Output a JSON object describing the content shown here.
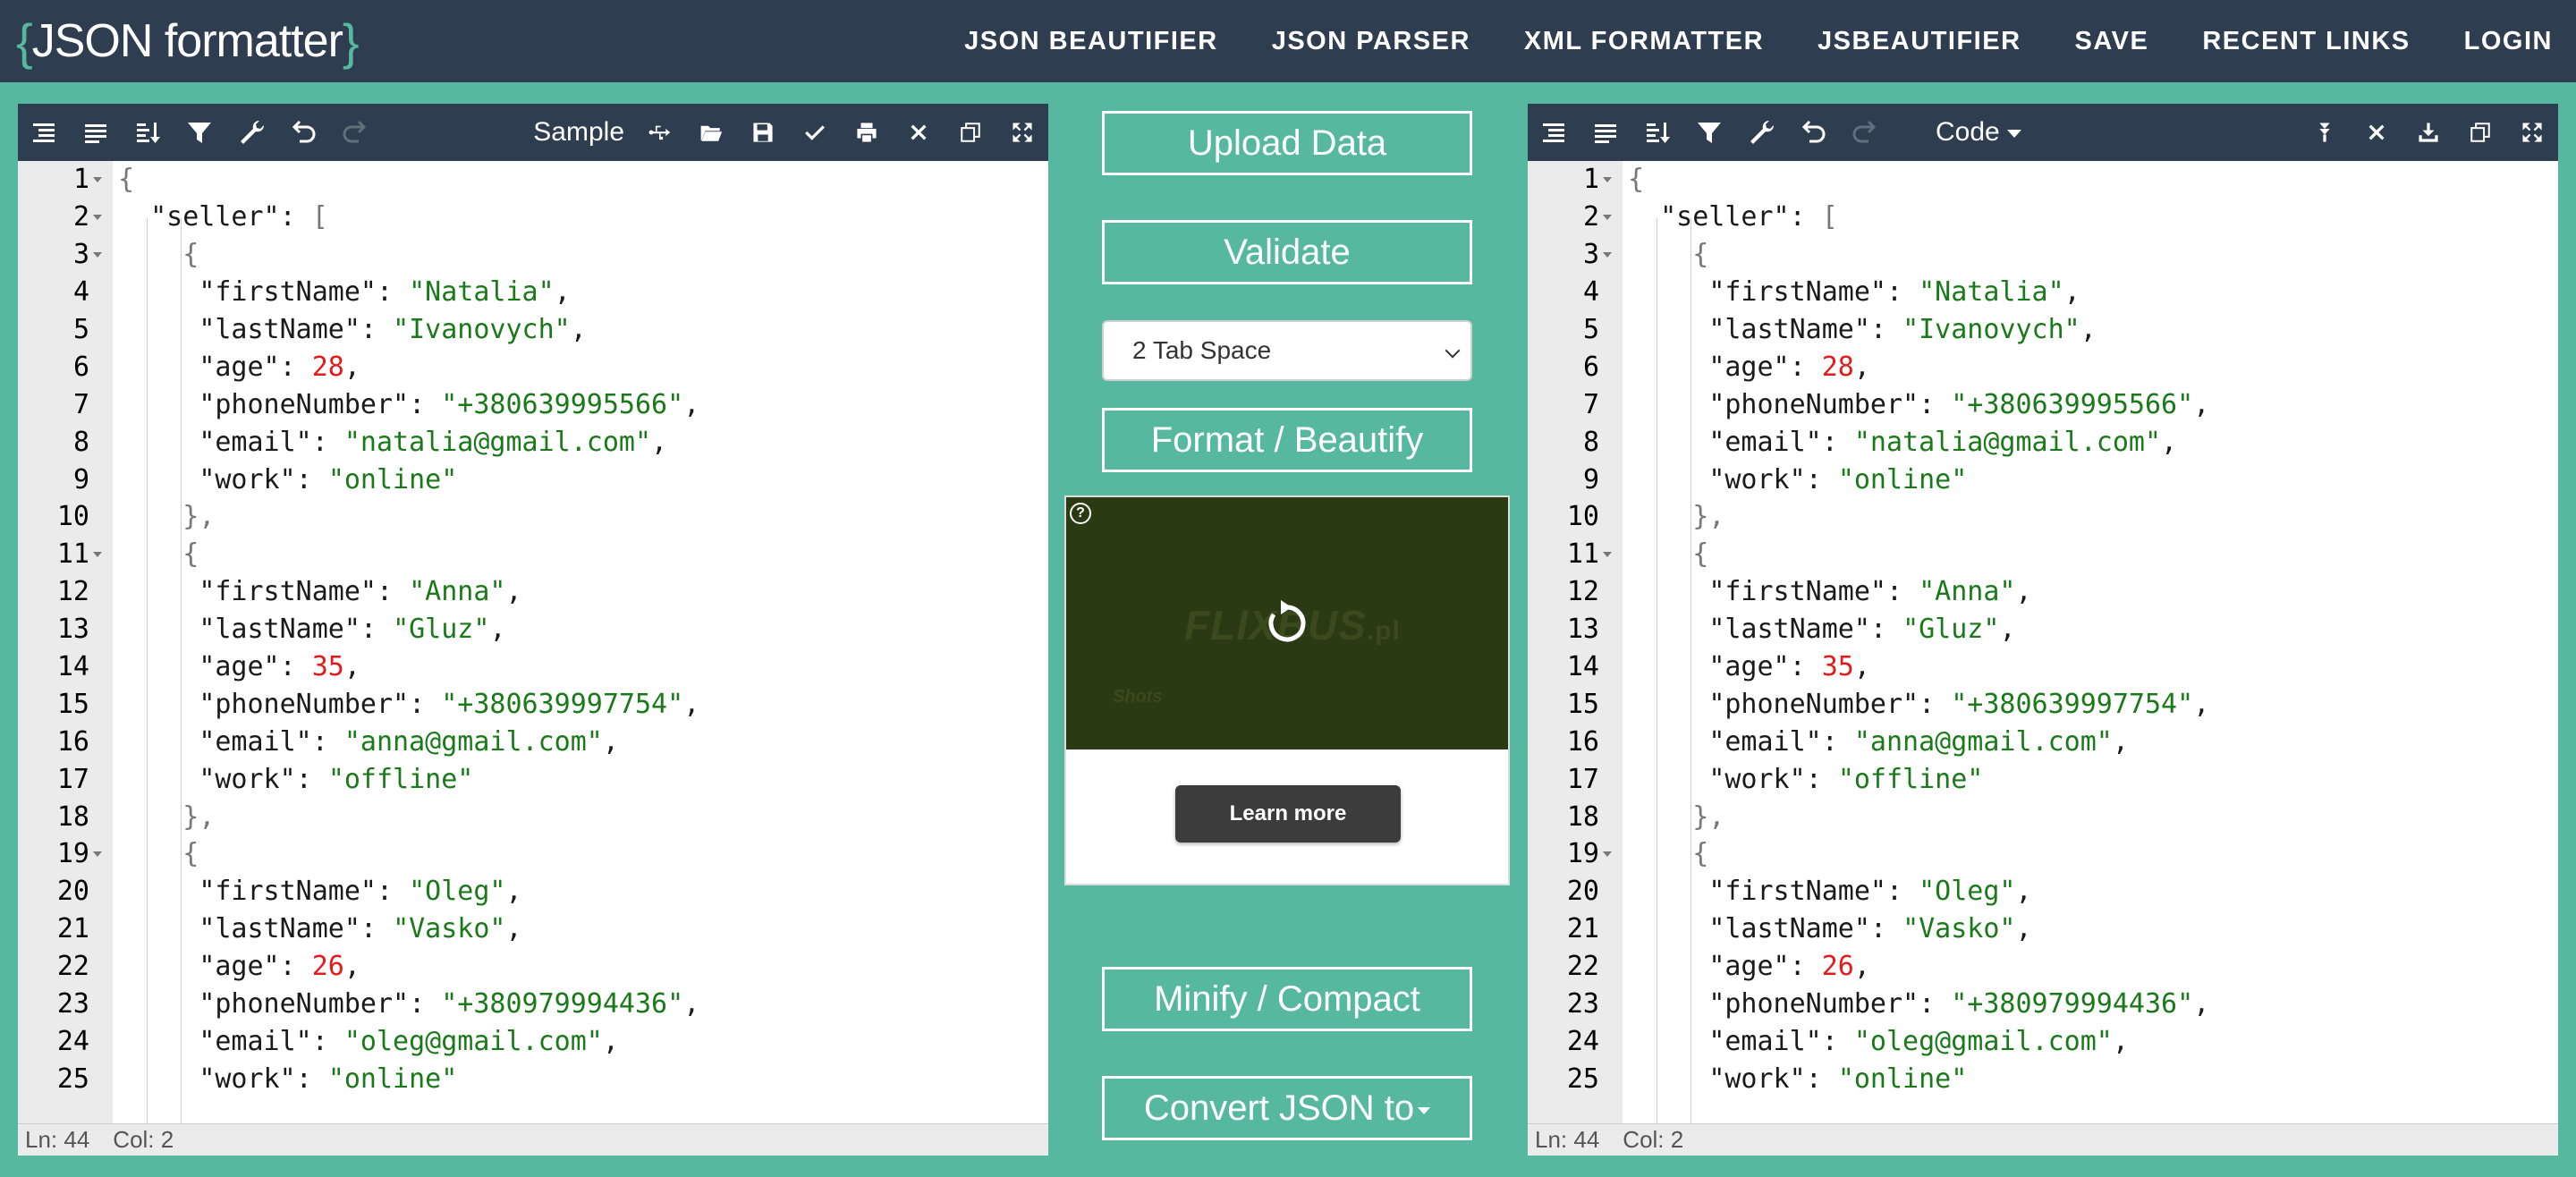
{
  "header": {
    "logo_open": "{",
    "logo_text": "JSON formatter",
    "logo_close": "}",
    "nav": [
      "JSON BEAUTIFIER",
      "JSON PARSER",
      "XML FORMATTER",
      "JSBEAUTIFIER",
      "SAVE",
      "RECENT LINKS",
      "LOGIN"
    ]
  },
  "left_pane": {
    "toolbar_label": "Sample",
    "status": {
      "line": "Ln: 44",
      "col": "Col: 2"
    }
  },
  "right_pane": {
    "toolbar_label": "Code",
    "status": {
      "line": "Ln: 44",
      "col": "Col: 2"
    }
  },
  "middle": {
    "upload_label": "Upload Data",
    "validate_label": "Validate",
    "tab_select_value": "2 Tab Space",
    "format_label": "Format / Beautify",
    "minify_label": "Minify / Compact",
    "convert_label": "Convert JSON to"
  },
  "ad": {
    "help": "?",
    "brand": "FLIXBUS",
    "brand_suffix": ".pl",
    "small_text": "Shots",
    "learn_more_label": "Learn more"
  },
  "colors": {
    "accent": "#56b89e",
    "header_bg": "#2e3d4f",
    "string": "#1a7a1a",
    "number": "#e31b1b"
  },
  "code_lines": [
    {
      "n": "1",
      "fold": true,
      "tokens": [
        [
          "b",
          "{"
        ]
      ]
    },
    {
      "n": "2",
      "fold": true,
      "tokens": [
        [
          "p",
          "  "
        ],
        [
          "k",
          "\"seller\""
        ],
        [
          "p",
          ": "
        ],
        [
          "b",
          "["
        ]
      ]
    },
    {
      "n": "3",
      "fold": true,
      "tokens": [
        [
          "p",
          "    "
        ],
        [
          "b",
          "{"
        ]
      ]
    },
    {
      "n": "4",
      "fold": false,
      "tokens": [
        [
          "p",
          "     "
        ],
        [
          "k",
          "\"firstName\""
        ],
        [
          "p",
          ": "
        ],
        [
          "s",
          "\"Natalia\""
        ],
        [
          "p",
          ","
        ]
      ]
    },
    {
      "n": "5",
      "fold": false,
      "tokens": [
        [
          "p",
          "     "
        ],
        [
          "k",
          "\"lastName\""
        ],
        [
          "p",
          ": "
        ],
        [
          "s",
          "\"Ivanovych\""
        ],
        [
          "p",
          ","
        ]
      ]
    },
    {
      "n": "6",
      "fold": false,
      "tokens": [
        [
          "p",
          "     "
        ],
        [
          "k",
          "\"age\""
        ],
        [
          "p",
          ": "
        ],
        [
          "n",
          "28"
        ],
        [
          "p",
          ","
        ]
      ]
    },
    {
      "n": "7",
      "fold": false,
      "tokens": [
        [
          "p",
          "     "
        ],
        [
          "k",
          "\"phoneNumber\""
        ],
        [
          "p",
          ": "
        ],
        [
          "s",
          "\"+380639995566\""
        ],
        [
          "p",
          ","
        ]
      ]
    },
    {
      "n": "8",
      "fold": false,
      "tokens": [
        [
          "p",
          "     "
        ],
        [
          "k",
          "\"email\""
        ],
        [
          "p",
          ": "
        ],
        [
          "s",
          "\"natalia@gmail.com\""
        ],
        [
          "p",
          ","
        ]
      ]
    },
    {
      "n": "9",
      "fold": false,
      "tokens": [
        [
          "p",
          "     "
        ],
        [
          "k",
          "\"work\""
        ],
        [
          "p",
          ": "
        ],
        [
          "s",
          "\"online\""
        ]
      ]
    },
    {
      "n": "10",
      "fold": false,
      "tokens": [
        [
          "p",
          "    "
        ],
        [
          "b",
          "},"
        ]
      ]
    },
    {
      "n": "11",
      "fold": true,
      "tokens": [
        [
          "p",
          "    "
        ],
        [
          "b",
          "{"
        ]
      ]
    },
    {
      "n": "12",
      "fold": false,
      "tokens": [
        [
          "p",
          "     "
        ],
        [
          "k",
          "\"firstName\""
        ],
        [
          "p",
          ": "
        ],
        [
          "s",
          "\"Anna\""
        ],
        [
          "p",
          ","
        ]
      ]
    },
    {
      "n": "13",
      "fold": false,
      "tokens": [
        [
          "p",
          "     "
        ],
        [
          "k",
          "\"lastName\""
        ],
        [
          "p",
          ": "
        ],
        [
          "s",
          "\"Gluz\""
        ],
        [
          "p",
          ","
        ]
      ]
    },
    {
      "n": "14",
      "fold": false,
      "tokens": [
        [
          "p",
          "     "
        ],
        [
          "k",
          "\"age\""
        ],
        [
          "p",
          ": "
        ],
        [
          "n",
          "35"
        ],
        [
          "p",
          ","
        ]
      ]
    },
    {
      "n": "15",
      "fold": false,
      "tokens": [
        [
          "p",
          "     "
        ],
        [
          "k",
          "\"phoneNumber\""
        ],
        [
          "p",
          ": "
        ],
        [
          "s",
          "\"+380639997754\""
        ],
        [
          "p",
          ","
        ]
      ]
    },
    {
      "n": "16",
      "fold": false,
      "tokens": [
        [
          "p",
          "     "
        ],
        [
          "k",
          "\"email\""
        ],
        [
          "p",
          ": "
        ],
        [
          "s",
          "\"anna@gmail.com\""
        ],
        [
          "p",
          ","
        ]
      ]
    },
    {
      "n": "17",
      "fold": false,
      "tokens": [
        [
          "p",
          "     "
        ],
        [
          "k",
          "\"work\""
        ],
        [
          "p",
          ": "
        ],
        [
          "s",
          "\"offline\""
        ]
      ]
    },
    {
      "n": "18",
      "fold": false,
      "tokens": [
        [
          "p",
          "    "
        ],
        [
          "b",
          "},"
        ]
      ]
    },
    {
      "n": "19",
      "fold": true,
      "tokens": [
        [
          "p",
          "    "
        ],
        [
          "b",
          "{"
        ]
      ]
    },
    {
      "n": "20",
      "fold": false,
      "tokens": [
        [
          "p",
          "     "
        ],
        [
          "k",
          "\"firstName\""
        ],
        [
          "p",
          ": "
        ],
        [
          "s",
          "\"Oleg\""
        ],
        [
          "p",
          ","
        ]
      ]
    },
    {
      "n": "21",
      "fold": false,
      "tokens": [
        [
          "p",
          "     "
        ],
        [
          "k",
          "\"lastName\""
        ],
        [
          "p",
          ": "
        ],
        [
          "s",
          "\"Vasko\""
        ],
        [
          "p",
          ","
        ]
      ]
    },
    {
      "n": "22",
      "fold": false,
      "tokens": [
        [
          "p",
          "     "
        ],
        [
          "k",
          "\"age\""
        ],
        [
          "p",
          ": "
        ],
        [
          "n",
          "26"
        ],
        [
          "p",
          ","
        ]
      ]
    },
    {
      "n": "23",
      "fold": false,
      "tokens": [
        [
          "p",
          "     "
        ],
        [
          "k",
          "\"phoneNumber\""
        ],
        [
          "p",
          ": "
        ],
        [
          "s",
          "\"+380979994436\""
        ],
        [
          "p",
          ","
        ]
      ]
    },
    {
      "n": "24",
      "fold": false,
      "tokens": [
        [
          "p",
          "     "
        ],
        [
          "k",
          "\"email\""
        ],
        [
          "p",
          ": "
        ],
        [
          "s",
          "\"oleg@gmail.com\""
        ],
        [
          "p",
          ","
        ]
      ]
    },
    {
      "n": "25",
      "fold": false,
      "tokens": [
        [
          "p",
          "     "
        ],
        [
          "k",
          "\"work\""
        ],
        [
          "p",
          ": "
        ],
        [
          "s",
          "\"online\""
        ]
      ]
    }
  ]
}
